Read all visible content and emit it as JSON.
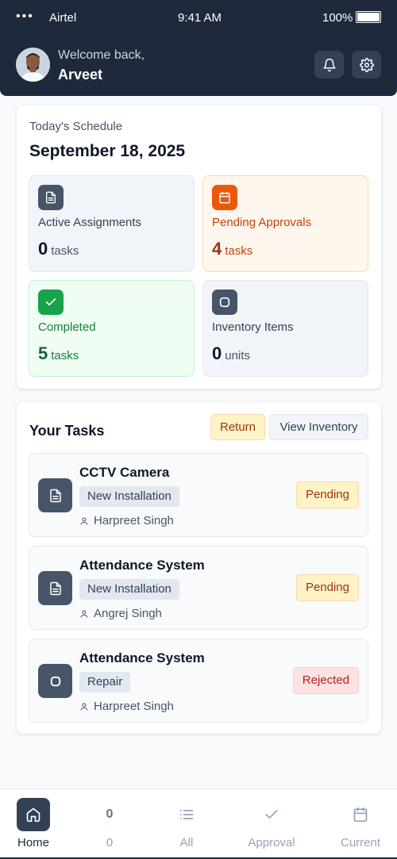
{
  "status_bar": {
    "dots": "•••",
    "carrier": "Airtel",
    "time": "9:41 AM",
    "battery": "100%"
  },
  "header": {
    "welcome": "Welcome back,",
    "username": "Arveet"
  },
  "schedule": {
    "label": "Today's Schedule",
    "date": "September 18, 2025",
    "stats": [
      {
        "label": "Active Assignments",
        "value": "0",
        "unit": "tasks",
        "icon": "document-icon",
        "color": "#475569"
      },
      {
        "label": "Pending Approvals",
        "value": "4",
        "unit": "tasks",
        "icon": "calendar-icon",
        "color": "#ea580c"
      },
      {
        "label": "Completed",
        "value": "5",
        "unit": "tasks",
        "icon": "check-icon",
        "color": "#16a34a"
      },
      {
        "label": "Inventory Items",
        "value": "0",
        "unit": "units",
        "icon": "box-icon",
        "color": "#475569"
      }
    ]
  },
  "tasks": {
    "title": "Your Tasks",
    "return_label": "Return",
    "inventory_label": "View Inventory",
    "items": [
      {
        "title": "CCTV Camera",
        "tag": "New Installation",
        "person": "Harpreet Singh",
        "status": "Pending",
        "icon": "document-icon"
      },
      {
        "title": "Attendance System",
        "tag": "New Installation",
        "person": "Angrej Singh",
        "status": "Pending",
        "icon": "document-icon"
      },
      {
        "title": "Attendance System",
        "tag": "Repair",
        "person": "Harpreet Singh",
        "status": "Rejected",
        "icon": "box-icon"
      }
    ]
  },
  "nav": {
    "items": [
      {
        "label": "Home",
        "icon": "home-icon"
      },
      {
        "label": "0",
        "count": "0"
      },
      {
        "label": "All",
        "icon": "list-icon"
      },
      {
        "label": "Approval",
        "icon": "check-icon"
      },
      {
        "label": "Current",
        "icon": "calendar-icon"
      }
    ]
  },
  "colors": {
    "header_bg": "#1e293b",
    "pending": "#9a3412",
    "rejected": "#b91c1c",
    "completed": "#15803d"
  }
}
